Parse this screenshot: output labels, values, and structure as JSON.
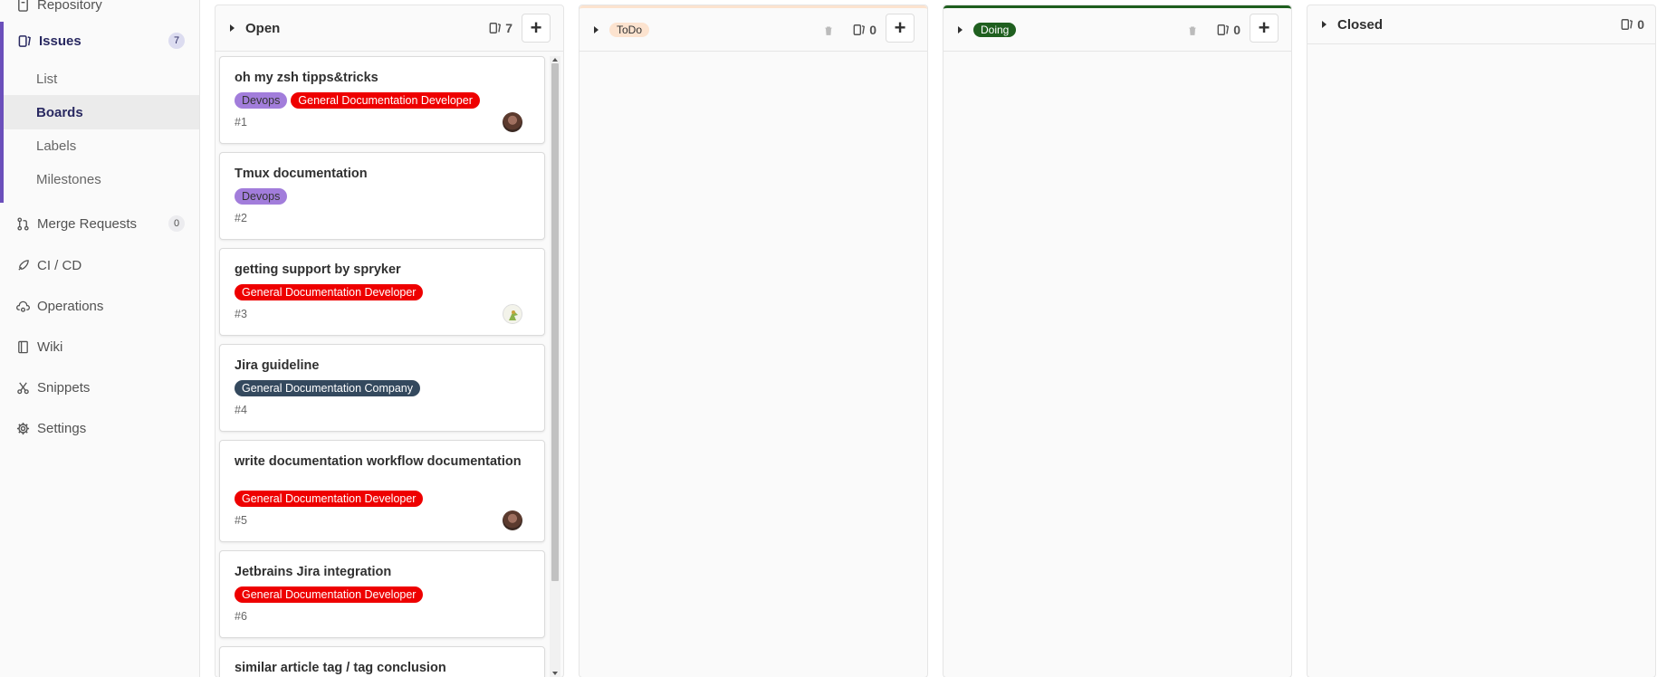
{
  "sidebar": {
    "repository_label": "Repository",
    "issues": {
      "label": "Issues",
      "count": "7"
    },
    "sub_items": [
      "List",
      "Boards",
      "Labels",
      "Milestones"
    ],
    "merge_requests": {
      "label": "Merge Requests",
      "count": "0"
    },
    "items": [
      "CI / CD",
      "Operations",
      "Wiki",
      "Snippets",
      "Settings"
    ]
  },
  "board": {
    "lists": [
      {
        "title": "Open",
        "count": "7"
      },
      {
        "title": "ToDo",
        "count": "0",
        "color": "#fce3cf"
      },
      {
        "title": "Doing",
        "count": "0",
        "color": "#1f5f1f"
      },
      {
        "title": "Closed",
        "count": "0"
      }
    ],
    "cards": [
      {
        "title": "oh my zsh tipps&tricks",
        "labels": [
          "Devops",
          "General Documentation Developer"
        ],
        "number": "#1"
      },
      {
        "title": "Tmux documentation",
        "labels": [
          "Devops"
        ],
        "number": "#2"
      },
      {
        "title": "getting support by spryker",
        "labels": [
          "General Documentation Developer"
        ],
        "number": "#3"
      },
      {
        "title": "Jira guideline",
        "labels": [
          "General Documentation Company"
        ],
        "number": "#4"
      },
      {
        "title": "write documentation workflow documentation",
        "labels": [
          "General Documentation Developer"
        ],
        "number": "#5"
      },
      {
        "title": "Jetbrains Jira integration",
        "labels": [
          "General Documentation Developer"
        ],
        "number": "#6"
      },
      {
        "title": "similar article tag / tag conclusion"
      }
    ]
  },
  "colors": {
    "accent": "#6b4fbb",
    "devops_label": "#a27ddb",
    "developer_label": "#ee0000",
    "company_label": "#34495e"
  }
}
